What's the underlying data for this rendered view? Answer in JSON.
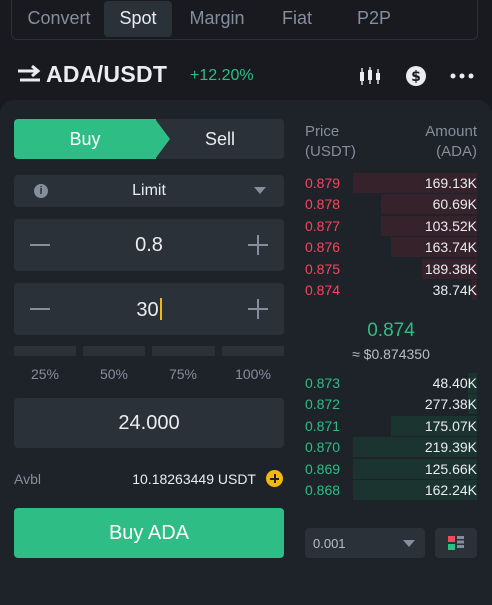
{
  "tabs": [
    "Convert",
    "Spot",
    "Margin",
    "Fiat",
    "P2P"
  ],
  "active_tab": "Spot",
  "pair": {
    "name": "ADA/USDT",
    "change": "+12.20%",
    "icons": [
      "swap-arrows-icon",
      "candlestick-chart-icon",
      "dollar-circle-icon",
      "more-icon"
    ]
  },
  "order_form": {
    "side_buy": "Buy",
    "side_sell": "Sell",
    "active_side": "Buy",
    "order_type": "Limit",
    "price": "0.8",
    "amount": "30",
    "percentages": [
      "25%",
      "50%",
      "75%",
      "100%"
    ],
    "total": "24.000",
    "avbl_label": "Avbl",
    "avbl_value": "10.18263449 USDT",
    "submit_label": "Buy ADA"
  },
  "orderbook": {
    "price_header": "Price",
    "price_unit": "(USDT)",
    "amount_header": "Amount",
    "amount_unit": "(ADA)",
    "asks": [
      {
        "price": "0.879",
        "amount": "169.13K",
        "depth": 0.72
      },
      {
        "price": "0.878",
        "amount": "60.69K",
        "depth": 0.56
      },
      {
        "price": "0.877",
        "amount": "103.52K",
        "depth": 0.56
      },
      {
        "price": "0.876",
        "amount": "163.74K",
        "depth": 0.5
      },
      {
        "price": "0.875",
        "amount": "189.38K",
        "depth": 0.32
      },
      {
        "price": "0.874",
        "amount": "38.74K",
        "depth": 0.03
      }
    ],
    "mid_price": "0.874",
    "mid_fiat": "≈ $0.874350",
    "bids": [
      {
        "price": "0.873",
        "amount": "48.40K",
        "depth": 0.05
      },
      {
        "price": "0.872",
        "amount": "277.38K",
        "depth": 0.05
      },
      {
        "price": "0.871",
        "amount": "175.07K",
        "depth": 0.5
      },
      {
        "price": "0.870",
        "amount": "219.39K",
        "depth": 0.72
      },
      {
        "price": "0.869",
        "amount": "125.66K",
        "depth": 0.72
      },
      {
        "price": "0.868",
        "amount": "162.24K",
        "depth": 0.72
      }
    ],
    "tick_size": "0.001"
  },
  "colors": {
    "buy": "#2ebd85",
    "sell": "#f6465d",
    "accent": "#f0b90b",
    "background": "#181a20",
    "panel": "#1e2329"
  }
}
